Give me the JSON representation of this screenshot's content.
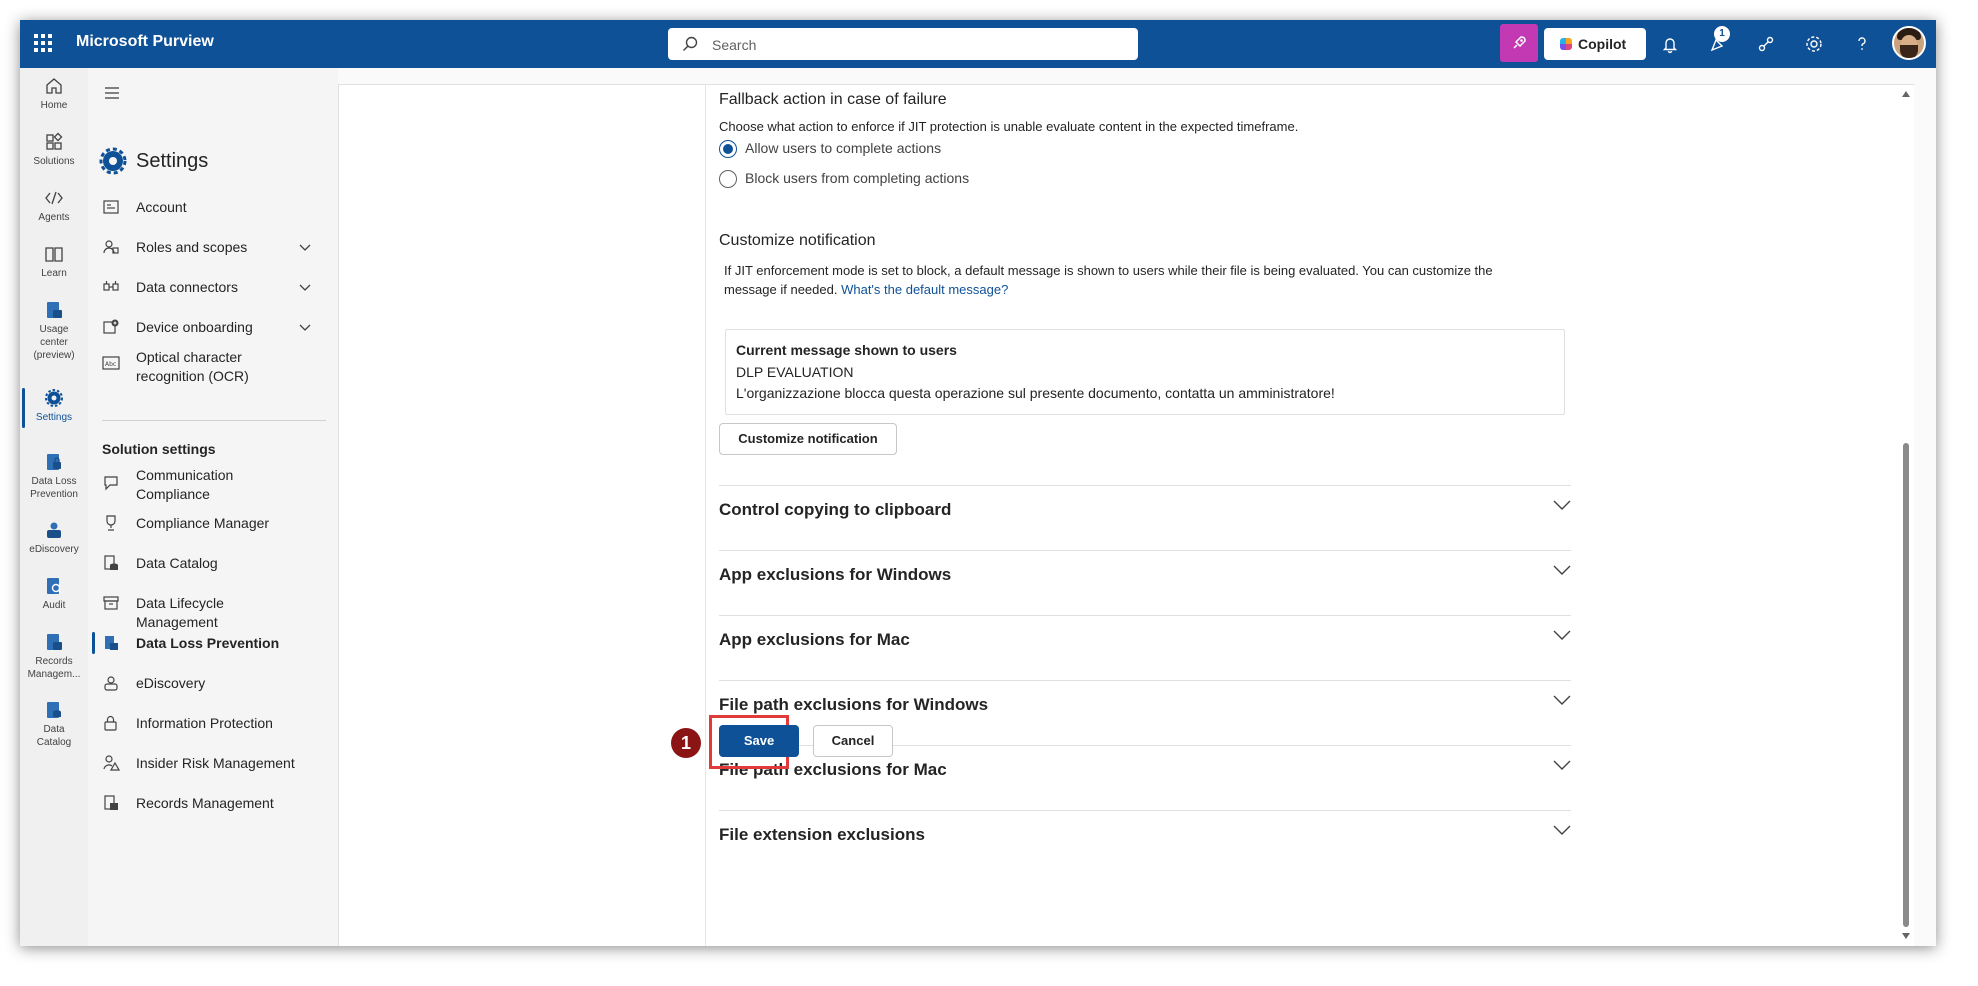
{
  "topbar": {
    "app_title": "Microsoft Purview",
    "search_placeholder": "Search",
    "copilot_label": "Copilot",
    "notification_badge": "1",
    "brand_color": "#0f5196"
  },
  "rail": [
    {
      "label": "Home",
      "icon": "home-icon"
    },
    {
      "label": "Solutions",
      "icon": "solutions-icon"
    },
    {
      "label": "Agents",
      "icon": "agents-icon"
    },
    {
      "label": "Learn",
      "icon": "learn-icon"
    },
    {
      "label": "Usage center (preview)",
      "icon": "usage-center-icon"
    },
    {
      "label": "Settings",
      "icon": "gear-icon"
    },
    {
      "label": "Data Loss Prevention",
      "icon": "dlp-icon"
    },
    {
      "label": "eDiscovery",
      "icon": "ediscovery-icon"
    },
    {
      "label": "Audit",
      "icon": "audit-icon"
    },
    {
      "label": "Records Managem...",
      "icon": "records-icon"
    },
    {
      "label": "Data Catalog",
      "icon": "data-catalog-icon"
    }
  ],
  "nav": {
    "title": "Settings",
    "items": [
      {
        "label": "Account"
      },
      {
        "label": "Roles and scopes"
      },
      {
        "label": "Data connectors"
      },
      {
        "label": "Device onboarding"
      },
      {
        "label": "Optical character recognition (OCR)"
      }
    ],
    "section_title": "Solution settings",
    "solution_items": [
      {
        "label": "Communication Compliance"
      },
      {
        "label": "Compliance Manager"
      },
      {
        "label": "Data Catalog"
      },
      {
        "label": "Data Lifecycle Management"
      },
      {
        "label": "Data Loss Prevention"
      },
      {
        "label": "eDiscovery"
      },
      {
        "label": "Information Protection"
      },
      {
        "label": "Insider Risk Management"
      },
      {
        "label": "Records Management"
      }
    ]
  },
  "main": {
    "fallback_title": "Fallback action in case of failure",
    "fallback_desc": "Choose what action to enforce if JIT protection is unable evaluate content in the expected timeframe.",
    "radio_allow": "Allow users to complete actions",
    "radio_block": "Block users from completing actions",
    "notif_title": "Customize notification",
    "notif_desc_1": "If JIT enforcement mode is set to block, a default message is shown to users while their file is being evaluated. You can customize the",
    "notif_desc_2": "message if needed.",
    "notif_link": "What's the default message?",
    "msg_title": "Current message shown to users",
    "msg_line1": "DLP EVALUATION",
    "msg_line2": "L'organizzazione blocca questa operazione sul presente documento, contatta un amministratore!",
    "customize_btn": "Customize notification",
    "accordions": [
      {
        "label": "Control copying to clipboard"
      },
      {
        "label": "App exclusions for Windows"
      },
      {
        "label": "App exclusions for Mac"
      },
      {
        "label": "File path exclusions for Windows"
      },
      {
        "label": "File path exclusions for Mac"
      },
      {
        "label": "File extension exclusions"
      }
    ],
    "save_label": "Save",
    "cancel_label": "Cancel",
    "step_number": "1"
  }
}
